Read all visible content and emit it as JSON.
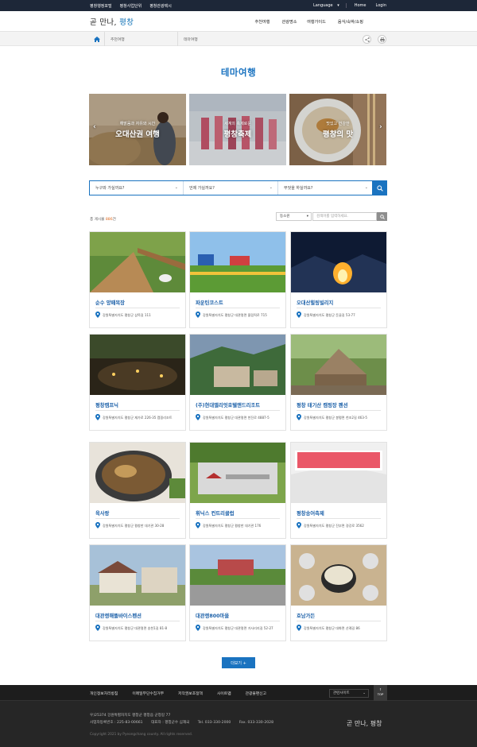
{
  "topbar": {
    "links": [
      "평창행정포털",
      "평창사업단위",
      "평창관광택시"
    ],
    "language": "Language",
    "home": "Home",
    "login": "Login"
  },
  "header": {
    "logo_a": "곧 만나,",
    "logo_b": "평창",
    "menu": [
      "추천여행",
      "관광명소",
      "여행가이드",
      "음식/숙박/쇼핑"
    ]
  },
  "breadcrumb": {
    "c1": "추천여행",
    "c2": "테마여행"
  },
  "page_title": "테마여행",
  "slides": [
    {
      "small": "해맑음과 자유와 시간",
      "big": "오대산권 여행"
    },
    {
      "small": "세계의 축제로운",
      "big": "평창축제"
    },
    {
      "small": "맛있고 건강한",
      "big": "평창의 맛"
    }
  ],
  "search": {
    "who": "누구와 가실까요?",
    "when": "언제 가실까요?",
    "what": "무엇을 하실까요?"
  },
  "list": {
    "count_label": "총 게시물",
    "count": "886",
    "count_unit": "건",
    "sort": "등소원",
    "keyword_placeholder": "검색어를 입력하세요."
  },
  "cards": [
    {
      "name": "순수 양떼목장",
      "addr": "강원특별자치도 평창군 삼목길 111"
    },
    {
      "name": "파운틴코스트",
      "addr": "강원특별자치도 평창군 대관령면 올림픽로 715"
    },
    {
      "name": "오대산힐링빌리지",
      "addr": "강원특별자치도 평창군 둔골길 53-77"
    },
    {
      "name": "평창캠프닉",
      "addr": "강원특별자치도 평창군 재가로 226-35 캠핑리조트"
    },
    {
      "name": "(주)현대앨리엇호텔앤드리조트",
      "addr": "강원특별자치도 평창군 대관령면 천진로 4887-5"
    },
    {
      "name": "평창 태기산 캠핑장 펜션",
      "addr": "강원특별자치도 평창군 봉평면 천조2길 463-5"
    },
    {
      "name": "육사랑",
      "addr": "강원특별자치도 평창군 평창한 대기관 30-28"
    },
    {
      "name": "휘닉스 컨트리클럽",
      "addr": "강원특별자치도 평창군 평창한 대기관 176"
    },
    {
      "name": "평창송어축제",
      "addr": "강원특별자치도 평창군 진부면 경강로 3562"
    },
    {
      "name": "대관령해뜰바이스펜션",
      "addr": "강원특별자치도 평창군 대관령면 송천1길 81-8"
    },
    {
      "name": "대관령800마을",
      "addr": "강원특별자치도 평창군 대관령면 거사리지길 52-27"
    },
    {
      "name": "호남가든",
      "addr": "강원특별자치도 평창군 대화면 산례길 86"
    }
  ],
  "more_button": "더보기 +",
  "footer": {
    "nav": [
      "개인정보처리방침",
      "이메일무단수집거부",
      "저작권보호정책",
      "사이트맵",
      "관광불편신고"
    ],
    "related_sites": "관련사이트",
    "top": "TOP",
    "address": "우)25374 강원특별자치도 평창군 평창읍 군청길 77",
    "biz_no": "사업자등록번호 : 225-83-00661",
    "ceo": "대표자 : 평창군수 심재국",
    "tel": "Tel. 033-330-2000",
    "fax": "Fax. 033-330-2028",
    "copyright": "Copyright 2021 by Pyeongchang county. All rights reserved.",
    "logo": "곧 만나, 평창"
  },
  "colors": {
    "accent": "#1a73c0",
    "topbar": "#1d2738",
    "footer": "#262626"
  }
}
